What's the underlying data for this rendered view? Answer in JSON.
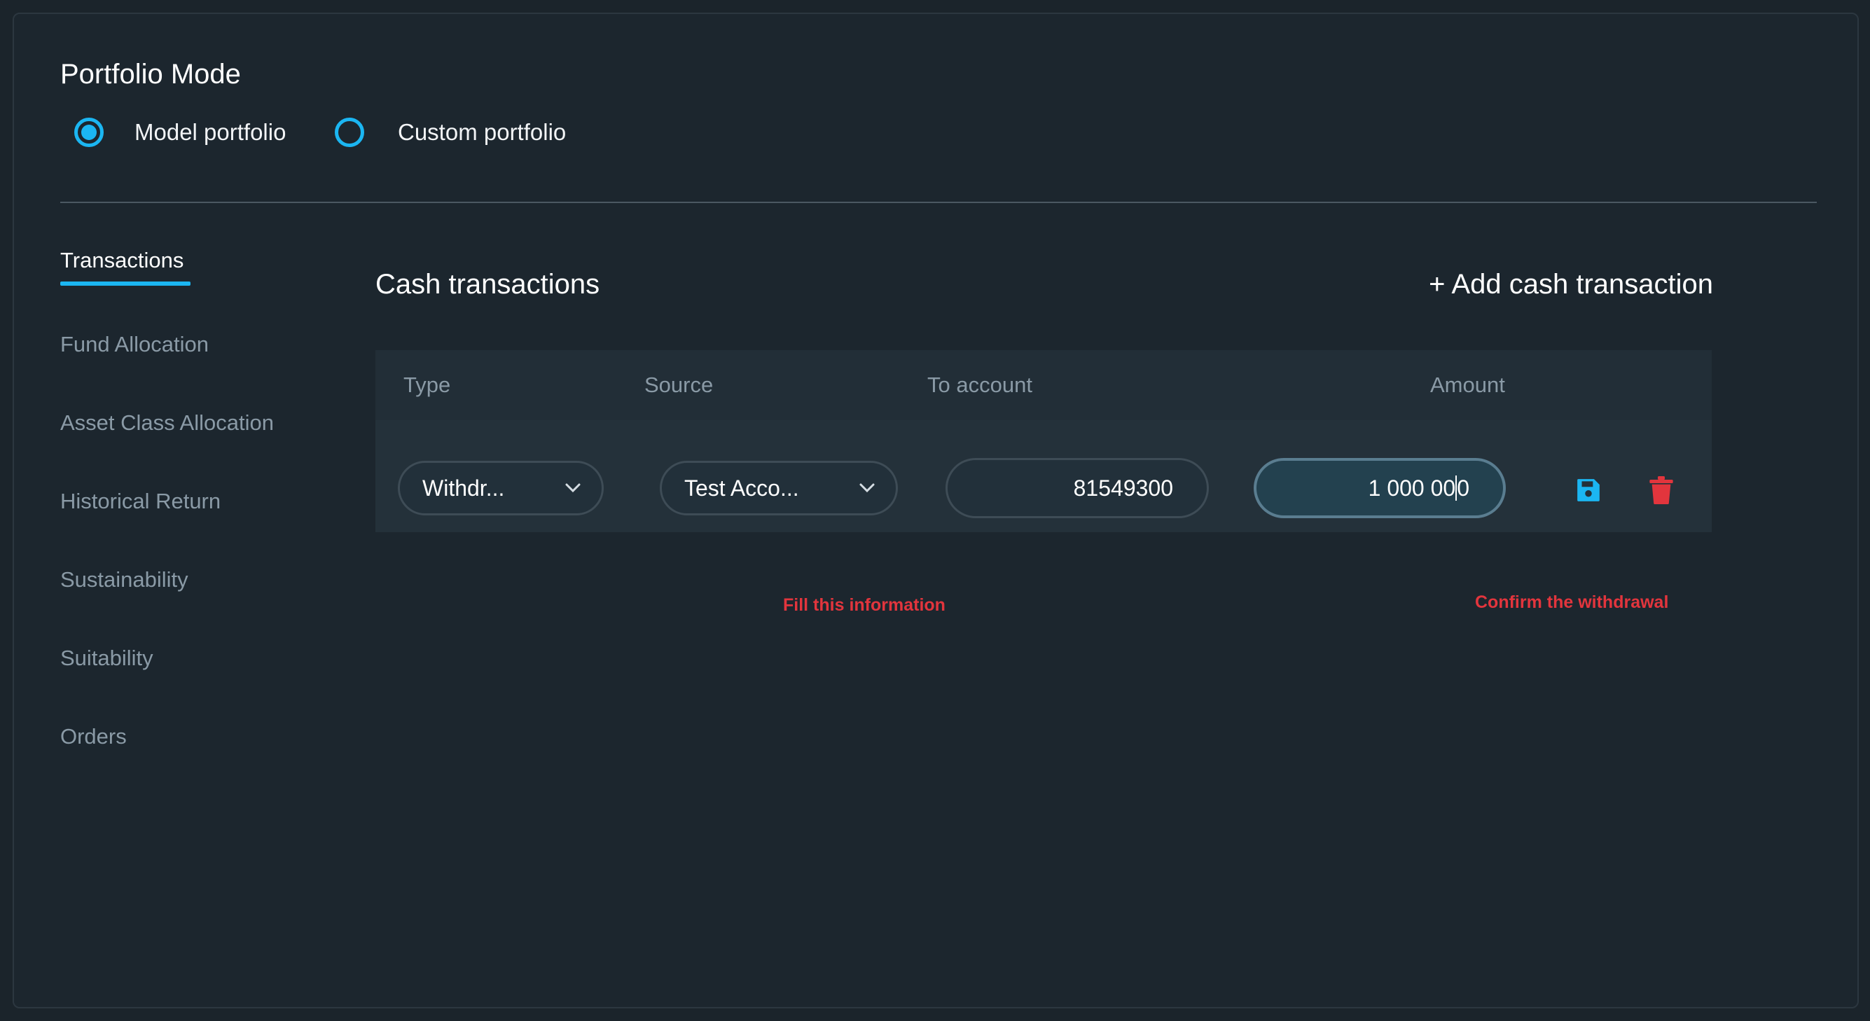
{
  "portfolio_mode": {
    "title": "Portfolio Mode",
    "options": [
      {
        "label": "Model portfolio",
        "selected": true
      },
      {
        "label": "Custom portfolio",
        "selected": false
      }
    ]
  },
  "nav": {
    "items": [
      {
        "label": "Transactions",
        "active": true
      },
      {
        "label": "Fund Allocation",
        "active": false
      },
      {
        "label": "Asset Class Allocation",
        "active": false
      },
      {
        "label": "Historical Return",
        "active": false
      },
      {
        "label": "Sustainability",
        "active": false
      },
      {
        "label": "Suitability",
        "active": false
      },
      {
        "label": "Orders",
        "active": false
      }
    ]
  },
  "cash_transactions": {
    "title": "Cash transactions",
    "add_button": "+ Add cash transaction",
    "columns": [
      "Type",
      "Source",
      "To account",
      "Amount"
    ],
    "row": {
      "type": "Withdr...",
      "source": "Test Acco...",
      "to_account": "81549300",
      "amount_before_caret": "1 000 00",
      "amount_after_caret": "0"
    }
  },
  "annotations": {
    "fill_info": "Fill this information",
    "confirm": "Confirm the withdrawal"
  },
  "icons": {
    "save": "floppy-disk-icon",
    "delete": "trash-icon",
    "chevron": "chevron-down-icon"
  },
  "colors": {
    "accent": "#1bb6f2",
    "danger": "#e2353d",
    "background": "#1c262e"
  }
}
